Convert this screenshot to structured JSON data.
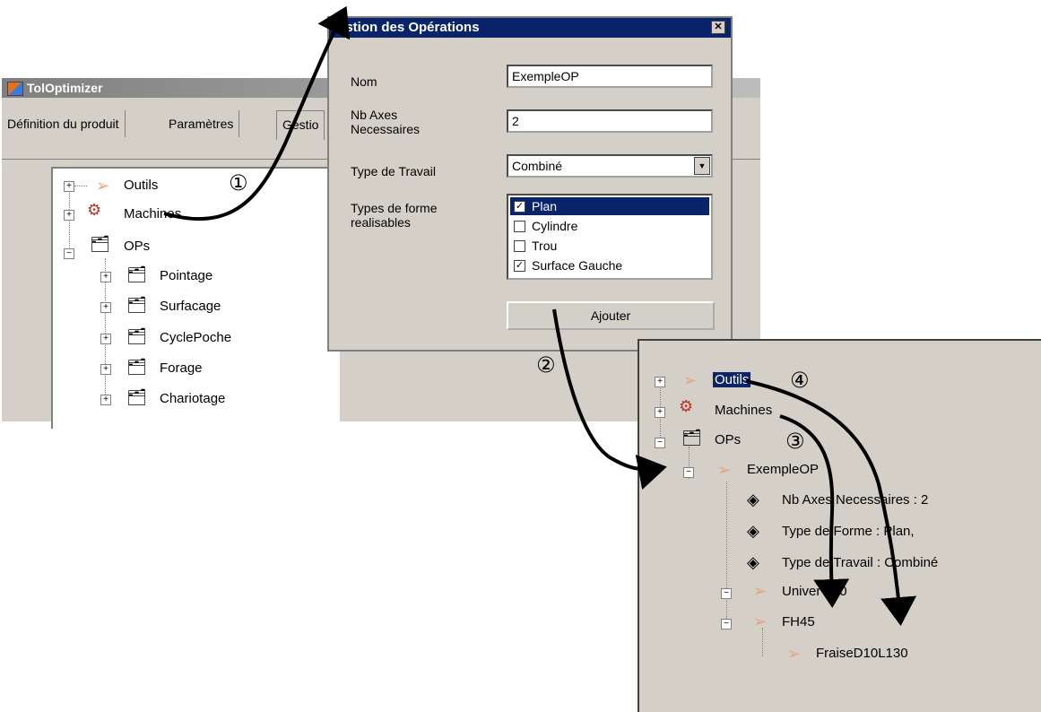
{
  "main_window": {
    "title": "TolOptimizer",
    "tabs": [
      "Définition du produit",
      "Paramètres",
      "Gestio"
    ],
    "tree": [
      {
        "label": "Outils",
        "expanded": false
      },
      {
        "label": "Machines",
        "expanded": false
      },
      {
        "label": "OPs",
        "expanded": true
      },
      {
        "label": "Pointage"
      },
      {
        "label": "Surfacage"
      },
      {
        "label": "CyclePoche"
      },
      {
        "label": "Forage"
      },
      {
        "label": "Chariotage"
      }
    ]
  },
  "dialog": {
    "title": "estion des Opérations",
    "close": "✕",
    "nom_label": "Nom",
    "nom_value": "ExempleOP",
    "axes_label_line1": "Nb Axes",
    "axes_label_line2": "Necessaires",
    "axes_value": "2",
    "travail_label": "Type de Travail",
    "travail_value": "Combiné",
    "formes_label_line1": "Types de forme",
    "formes_label_line2": "realisables",
    "formes": [
      {
        "label": "Plan",
        "checked": true,
        "selected": true
      },
      {
        "label": "Cylindre",
        "checked": false
      },
      {
        "label": "Trou",
        "checked": false
      },
      {
        "label": "Surface Gauche",
        "checked": true
      }
    ],
    "add_button": "Ajouter"
  },
  "result_tree": {
    "items": [
      "Outils",
      "Machines",
      "OPs",
      "ExempleOP",
      "Nb Axes Necessaires : 2",
      "Type de Forme : Plan,",
      "Type de Travail : Combiné",
      "Univer 200",
      "FH45",
      "FraiseD10L130"
    ]
  },
  "callouts": [
    "①",
    "②",
    "③",
    "④"
  ],
  "colors": {
    "selection": "#0a246a",
    "window_bg": "#d4d0c8",
    "arrow": "#000000"
  }
}
